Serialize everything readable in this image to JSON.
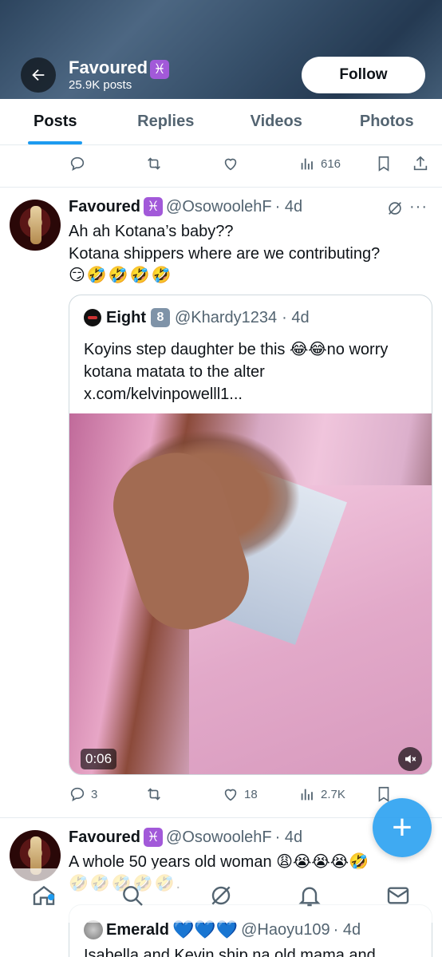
{
  "header": {
    "name": "Favoured",
    "badge": "♓",
    "posts_count": "25.9K posts",
    "follow_label": "Follow"
  },
  "tabs": [
    {
      "label": "Posts",
      "active": true
    },
    {
      "label": "Replies",
      "active": false
    },
    {
      "label": "Videos",
      "active": false
    },
    {
      "label": "Photos",
      "active": false
    }
  ],
  "top_actions": {
    "views": "616"
  },
  "tweet1": {
    "name": "Favoured",
    "badge": "♓",
    "handle": "@OsowoolehF",
    "time": "· 4d",
    "line1": "Ah ah Kotana’s baby??",
    "line2": "Kotana shippers where are we contributing?",
    "emojis": "😏🤣🤣🤣🤣",
    "quote": {
      "name": "Eight",
      "badge": "8",
      "handle": "@Khardy1234",
      "time": "· 4d",
      "text": "Koyins step daughter be this 😂😂no worry kotana matata to the alter x.com/kelvinpowelll1...",
      "duration": "0:06"
    },
    "actions": {
      "replies": "3",
      "likes": "18",
      "views": "2.7K"
    }
  },
  "tweet2": {
    "name": "Favoured",
    "badge": "♓",
    "handle": "@OsowoolehF",
    "time": "· 4d",
    "text": "A whole 50 years old woman 😩😭😭😭🤣",
    "emojis": "🤣🤣🤣🤣🤣.",
    "quote": {
      "name": "Emerald",
      "hearts": "💙💙💙",
      "handle": "@Haoyu109",
      "time": "· 4d",
      "text": "Isabella and Kevin ship na old mama and"
    }
  },
  "fab_label": "+",
  "more_label": "···",
  "icons": {
    "back": "arrow-left-icon",
    "reply": "reply-icon",
    "retweet": "retweet-icon",
    "like": "heart-icon",
    "views": "views-icon",
    "bookmark": "bookmark-icon",
    "share": "share-icon",
    "grok": "grok-icon",
    "home": "home-icon",
    "search": "search-icon",
    "notifications": "bell-icon",
    "messages": "mail-icon"
  },
  "colors": {
    "accent": "#1d9bf0",
    "text_secondary": "#536471"
  }
}
